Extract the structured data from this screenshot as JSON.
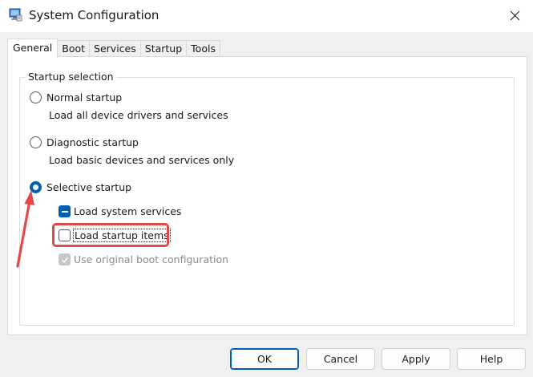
{
  "window": {
    "title": "System Configuration"
  },
  "tabs": [
    {
      "label": "General"
    },
    {
      "label": "Boot"
    },
    {
      "label": "Services"
    },
    {
      "label": "Startup"
    },
    {
      "label": "Tools"
    }
  ],
  "startup_selection": {
    "group_label": "Startup selection",
    "options": [
      {
        "label": "Normal startup",
        "description": "Load all device drivers and services"
      },
      {
        "label": "Diagnostic startup",
        "description": "Load basic devices and services only"
      },
      {
        "label": "Selective startup"
      }
    ],
    "selective_items": [
      {
        "label": "Load system services",
        "state": "indeterminate"
      },
      {
        "label": "Load startup items",
        "state": "unchecked"
      },
      {
        "label": "Use original boot configuration",
        "state": "checked-disabled"
      }
    ]
  },
  "buttons": {
    "ok": "OK",
    "cancel": "Cancel",
    "apply": "Apply",
    "help": "Help"
  },
  "colors": {
    "accent": "#005fb8",
    "annotation": "#e0484a"
  }
}
